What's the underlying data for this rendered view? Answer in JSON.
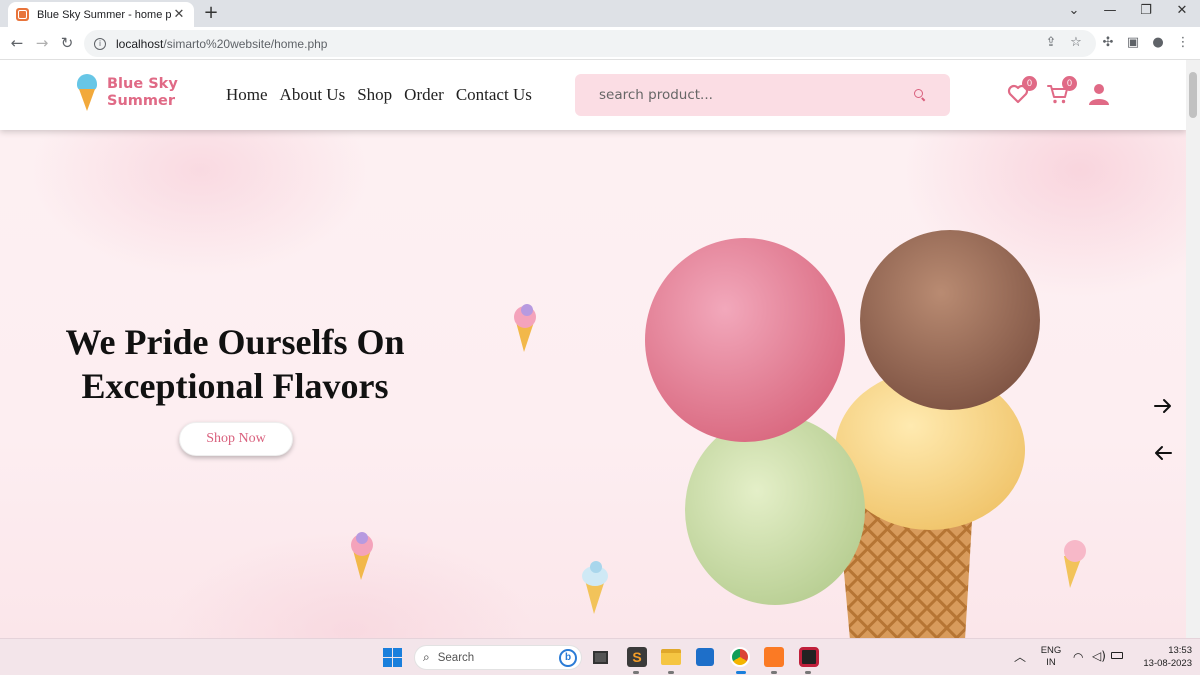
{
  "browser": {
    "tab_title": "Blue Sky Summer - home page",
    "tab_close": "✕",
    "new_tab": "+",
    "url_host": "localhost",
    "url_path": "/simarto%20website/home.php"
  },
  "site": {
    "logo_line1": "Blue Sky",
    "logo_line2": "Summer",
    "nav": [
      "Home",
      "About Us",
      "Shop",
      "Order",
      "Contact Us"
    ],
    "search_placeholder": "search product...",
    "wishlist_count": "0",
    "cart_count": "0"
  },
  "hero": {
    "title_line1": "We Pride Ourselfs On",
    "title_line2": "Exceptional Flavors",
    "cta": "Shop Now"
  },
  "taskbar": {
    "search_label": "Search",
    "lang_line1": "ENG",
    "lang_line2": "IN",
    "time": "13:53",
    "date": "13-08-2023"
  },
  "colors": {
    "accent": "#e06a86",
    "search_bg": "#fbdde4",
    "logo_scoop": "#67c6e6"
  }
}
